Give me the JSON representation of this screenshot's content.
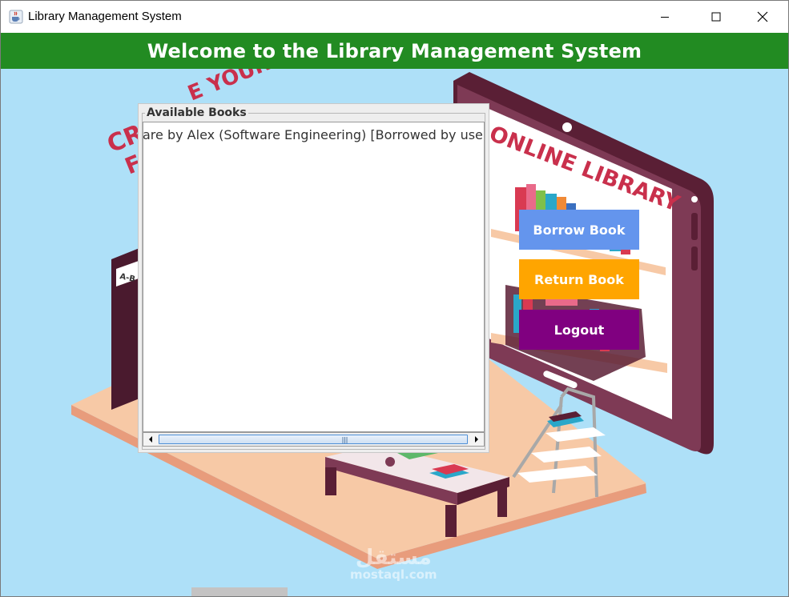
{
  "window": {
    "title": "Library Management System",
    "icon": "java-coffee-cup-icon"
  },
  "header": {
    "title": "Welcome to the Library Management System",
    "color": "#228b22"
  },
  "background": {
    "sign_text": "ONLINE LIBRARY",
    "slogan_visible": "CR... YOUR P...",
    "shelf_label": "A-B",
    "color": "#aee0f8"
  },
  "books_panel": {
    "title": "Available Books",
    "items": [
      "are by Alex (Software Engineering) [Borrowed by user]"
    ]
  },
  "actions": {
    "borrow": {
      "label": "Borrow Book",
      "color": "#6495ed"
    },
    "return": {
      "label": "Return Book",
      "color": "#ffa500"
    },
    "logout": {
      "label": "Logout",
      "color": "#800080"
    }
  },
  "watermark": {
    "arabic": "مستقل",
    "latin": "mostaql.com"
  }
}
